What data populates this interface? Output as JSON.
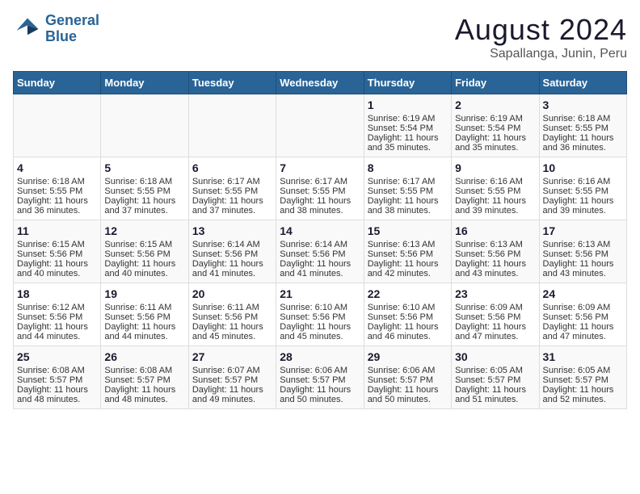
{
  "header": {
    "logo_line1": "General",
    "logo_line2": "Blue",
    "title": "August 2024",
    "subtitle": "Sapallanga, Junin, Peru"
  },
  "days_of_week": [
    "Sunday",
    "Monday",
    "Tuesday",
    "Wednesday",
    "Thursday",
    "Friday",
    "Saturday"
  ],
  "weeks": [
    [
      {
        "day": "",
        "info": ""
      },
      {
        "day": "",
        "info": ""
      },
      {
        "day": "",
        "info": ""
      },
      {
        "day": "",
        "info": ""
      },
      {
        "day": "1",
        "info": "Sunrise: 6:19 AM\nSunset: 5:54 PM\nDaylight: 11 hours\nand 35 minutes."
      },
      {
        "day": "2",
        "info": "Sunrise: 6:19 AM\nSunset: 5:54 PM\nDaylight: 11 hours\nand 35 minutes."
      },
      {
        "day": "3",
        "info": "Sunrise: 6:18 AM\nSunset: 5:55 PM\nDaylight: 11 hours\nand 36 minutes."
      }
    ],
    [
      {
        "day": "4",
        "info": "Sunrise: 6:18 AM\nSunset: 5:55 PM\nDaylight: 11 hours\nand 36 minutes."
      },
      {
        "day": "5",
        "info": "Sunrise: 6:18 AM\nSunset: 5:55 PM\nDaylight: 11 hours\nand 37 minutes."
      },
      {
        "day": "6",
        "info": "Sunrise: 6:17 AM\nSunset: 5:55 PM\nDaylight: 11 hours\nand 37 minutes."
      },
      {
        "day": "7",
        "info": "Sunrise: 6:17 AM\nSunset: 5:55 PM\nDaylight: 11 hours\nand 38 minutes."
      },
      {
        "day": "8",
        "info": "Sunrise: 6:17 AM\nSunset: 5:55 PM\nDaylight: 11 hours\nand 38 minutes."
      },
      {
        "day": "9",
        "info": "Sunrise: 6:16 AM\nSunset: 5:55 PM\nDaylight: 11 hours\nand 39 minutes."
      },
      {
        "day": "10",
        "info": "Sunrise: 6:16 AM\nSunset: 5:55 PM\nDaylight: 11 hours\nand 39 minutes."
      }
    ],
    [
      {
        "day": "11",
        "info": "Sunrise: 6:15 AM\nSunset: 5:56 PM\nDaylight: 11 hours\nand 40 minutes."
      },
      {
        "day": "12",
        "info": "Sunrise: 6:15 AM\nSunset: 5:56 PM\nDaylight: 11 hours\nand 40 minutes."
      },
      {
        "day": "13",
        "info": "Sunrise: 6:14 AM\nSunset: 5:56 PM\nDaylight: 11 hours\nand 41 minutes."
      },
      {
        "day": "14",
        "info": "Sunrise: 6:14 AM\nSunset: 5:56 PM\nDaylight: 11 hours\nand 41 minutes."
      },
      {
        "day": "15",
        "info": "Sunrise: 6:13 AM\nSunset: 5:56 PM\nDaylight: 11 hours\nand 42 minutes."
      },
      {
        "day": "16",
        "info": "Sunrise: 6:13 AM\nSunset: 5:56 PM\nDaylight: 11 hours\nand 43 minutes."
      },
      {
        "day": "17",
        "info": "Sunrise: 6:13 AM\nSunset: 5:56 PM\nDaylight: 11 hours\nand 43 minutes."
      }
    ],
    [
      {
        "day": "18",
        "info": "Sunrise: 6:12 AM\nSunset: 5:56 PM\nDaylight: 11 hours\nand 44 minutes."
      },
      {
        "day": "19",
        "info": "Sunrise: 6:11 AM\nSunset: 5:56 PM\nDaylight: 11 hours\nand 44 minutes."
      },
      {
        "day": "20",
        "info": "Sunrise: 6:11 AM\nSunset: 5:56 PM\nDaylight: 11 hours\nand 45 minutes."
      },
      {
        "day": "21",
        "info": "Sunrise: 6:10 AM\nSunset: 5:56 PM\nDaylight: 11 hours\nand 45 minutes."
      },
      {
        "day": "22",
        "info": "Sunrise: 6:10 AM\nSunset: 5:56 PM\nDaylight: 11 hours\nand 46 minutes."
      },
      {
        "day": "23",
        "info": "Sunrise: 6:09 AM\nSunset: 5:56 PM\nDaylight: 11 hours\nand 47 minutes."
      },
      {
        "day": "24",
        "info": "Sunrise: 6:09 AM\nSunset: 5:56 PM\nDaylight: 11 hours\nand 47 minutes."
      }
    ],
    [
      {
        "day": "25",
        "info": "Sunrise: 6:08 AM\nSunset: 5:57 PM\nDaylight: 11 hours\nand 48 minutes."
      },
      {
        "day": "26",
        "info": "Sunrise: 6:08 AM\nSunset: 5:57 PM\nDaylight: 11 hours\nand 48 minutes."
      },
      {
        "day": "27",
        "info": "Sunrise: 6:07 AM\nSunset: 5:57 PM\nDaylight: 11 hours\nand 49 minutes."
      },
      {
        "day": "28",
        "info": "Sunrise: 6:06 AM\nSunset: 5:57 PM\nDaylight: 11 hours\nand 50 minutes."
      },
      {
        "day": "29",
        "info": "Sunrise: 6:06 AM\nSunset: 5:57 PM\nDaylight: 11 hours\nand 50 minutes."
      },
      {
        "day": "30",
        "info": "Sunrise: 6:05 AM\nSunset: 5:57 PM\nDaylight: 11 hours\nand 51 minutes."
      },
      {
        "day": "31",
        "info": "Sunrise: 6:05 AM\nSunset: 5:57 PM\nDaylight: 11 hours\nand 52 minutes."
      }
    ]
  ]
}
